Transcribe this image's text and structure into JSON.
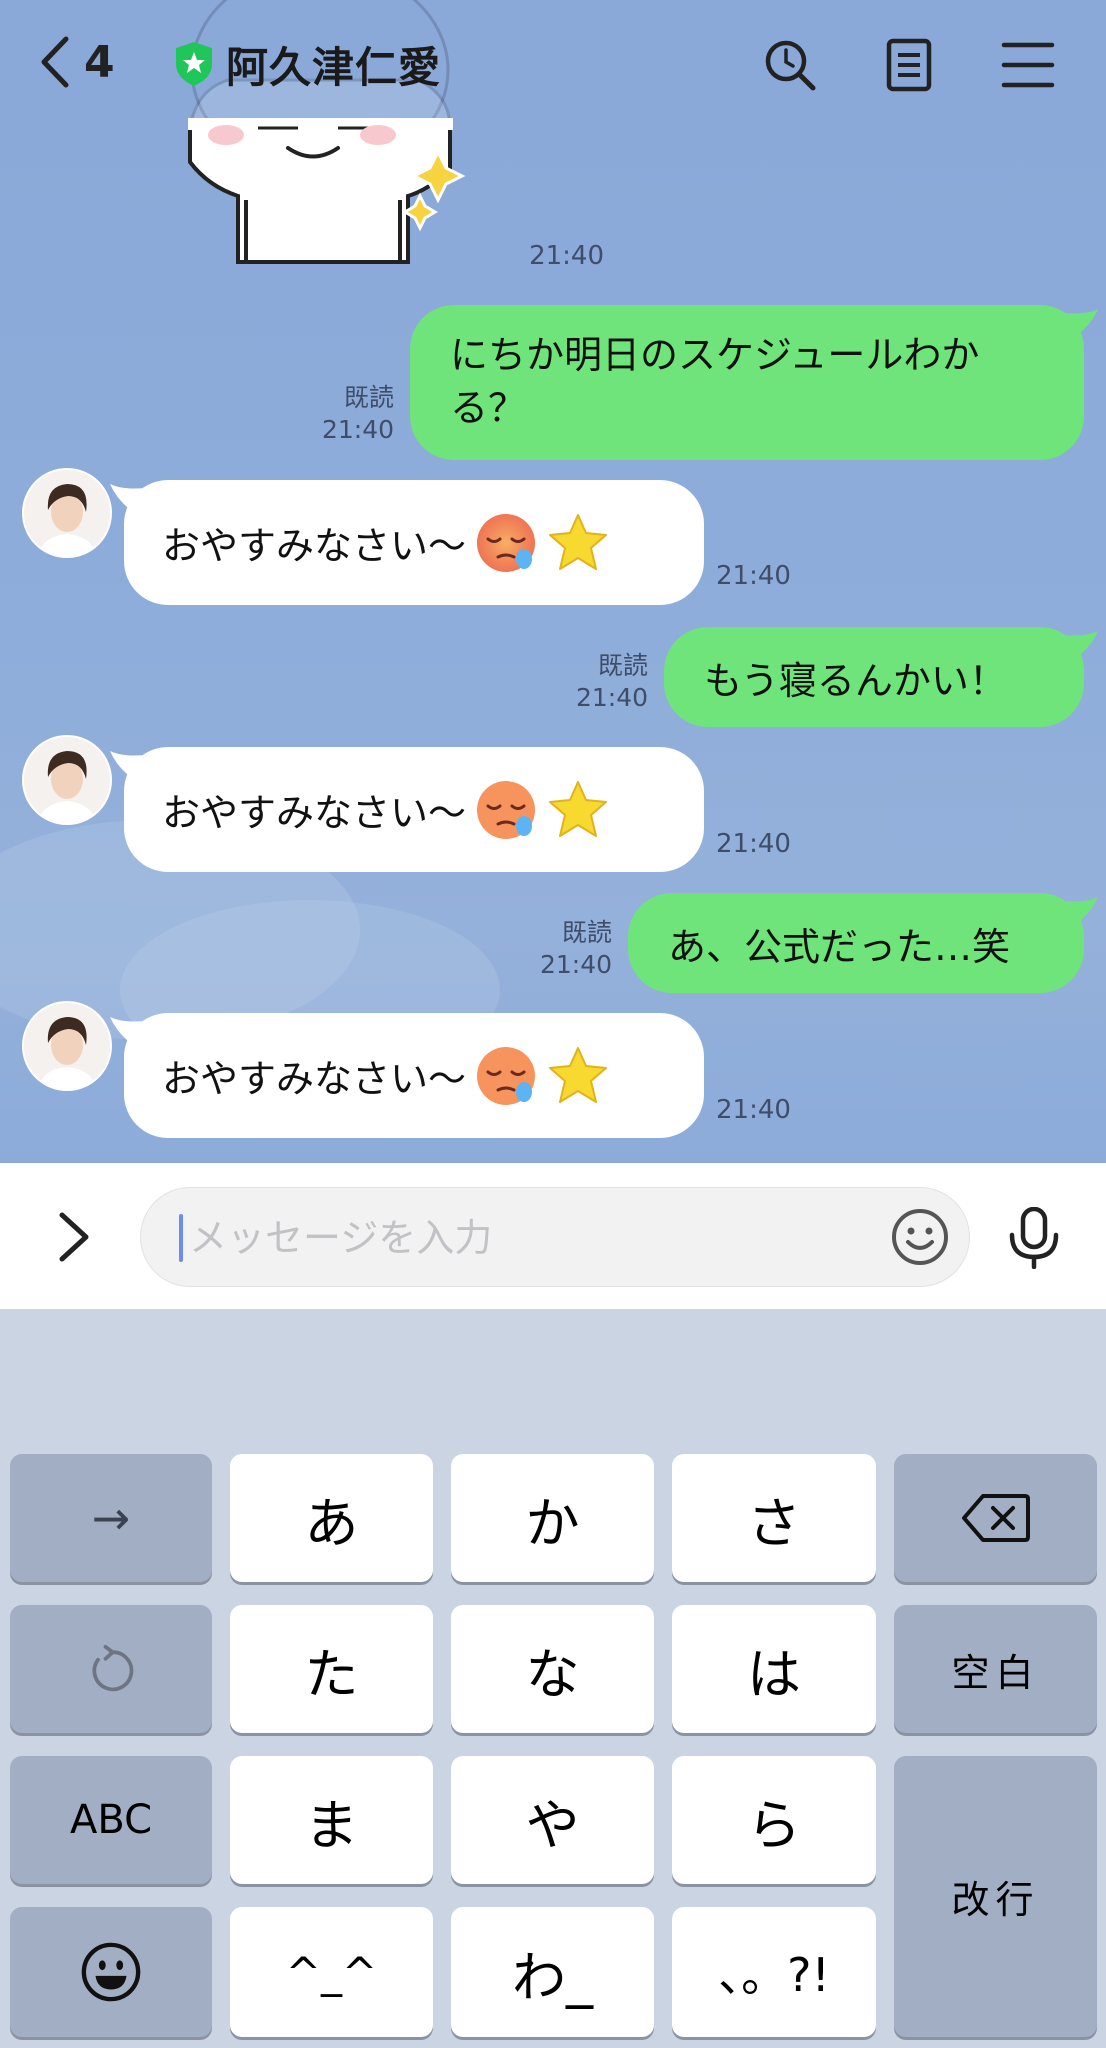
{
  "header": {
    "back_count": "4",
    "title": "阿久津仁愛"
  },
  "icons": {
    "back": "chevron-left-icon",
    "official": "shield-star-icon",
    "search": "search-icon",
    "notes": "notes-icon",
    "menu": "menu-icon",
    "expand": "chevron-right-icon",
    "emoji": "smiley-icon",
    "mic": "microphone-icon",
    "delete": "backspace-icon",
    "undo": "undo-icon",
    "keyboard_emoji": "emoji-icon",
    "arrow": "arrow-right-icon"
  },
  "colors": {
    "chat_bg": "#8eacdb",
    "my_bubble": "#6fe47a",
    "their_bubble": "#ffffff"
  },
  "messages": [
    {
      "type": "sticker",
      "sender": "other",
      "time": "21:40"
    },
    {
      "sender": "me",
      "text_line1": "にちか明日のスケジュールわか",
      "text_line2": "る？",
      "read": "既読",
      "time": "21:40"
    },
    {
      "sender": "other",
      "text": "おやすみなさい〜",
      "time": "21:40"
    },
    {
      "sender": "me",
      "text": "もう寝るんかい！",
      "read": "既読",
      "time": "21:40"
    },
    {
      "sender": "other",
      "text": "おやすみなさい〜",
      "time": "21:40"
    },
    {
      "sender": "me",
      "text": "あ、公式だった…笑",
      "read": "既読",
      "time": "21:40"
    },
    {
      "sender": "other",
      "text": "おやすみなさい〜",
      "time": "21:40"
    }
  ],
  "input": {
    "placeholder": "メッセージを入力"
  },
  "keyboard": {
    "arrow": "→",
    "a": "あ",
    "ka": "か",
    "sa": "さ",
    "ta": "た",
    "na": "な",
    "ha": "は",
    "space": "空白",
    "abc": "ABC",
    "ma": "ま",
    "ya": "や",
    "ra": "ら",
    "enter": "改行",
    "kaomoji": "^_^",
    "wa": "わ_",
    "punct": "、。?!"
  }
}
